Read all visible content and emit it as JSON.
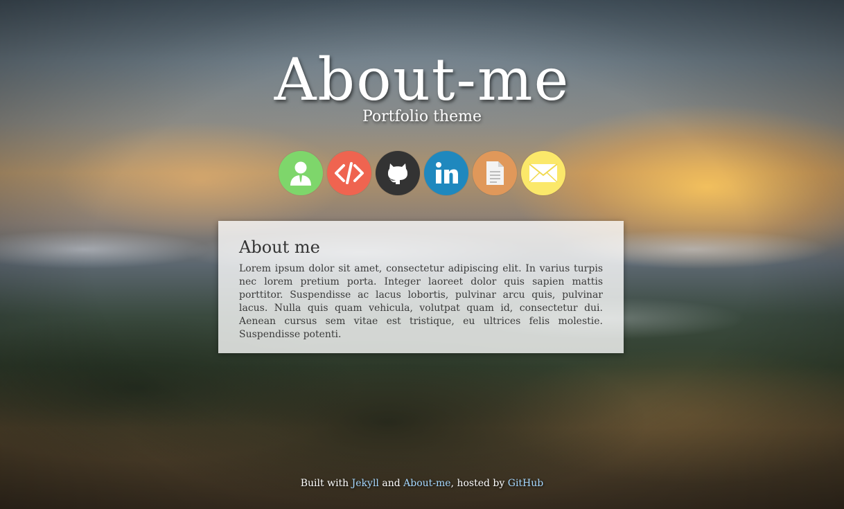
{
  "header": {
    "title": "About-me",
    "subtitle": "Portfolio theme"
  },
  "social": [
    {
      "name": "about-icon",
      "color": "#7ed66b"
    },
    {
      "name": "code-icon",
      "color": "#ef6450"
    },
    {
      "name": "github-icon",
      "color": "#333333"
    },
    {
      "name": "linkedin-icon",
      "color": "#1f88be"
    },
    {
      "name": "document-icon",
      "color": "#e0985a"
    },
    {
      "name": "mail-icon",
      "color": "#fbe86a"
    }
  ],
  "card": {
    "heading": "About me",
    "body": "Lorem ipsum dolor sit amet, consectetur adipiscing elit. In varius turpis nec lorem pretium porta. Integer laoreet dolor quis sapien mattis porttitor. Suspendisse ac lacus lobortis, pulvinar arcu quis, pulvinar lacus. Nulla quis quam vehicula, volutpat quam id, consectetur dui. Aenean cursus sem vitae est tristique, eu ultrices felis molestie. Suspendisse potenti."
  },
  "footer": {
    "built_with": "Built with",
    "jekyll": "Jekyll",
    "and": "and",
    "about_me": "About-me",
    "hosted_by": ", hosted by",
    "github": "GitHub"
  }
}
